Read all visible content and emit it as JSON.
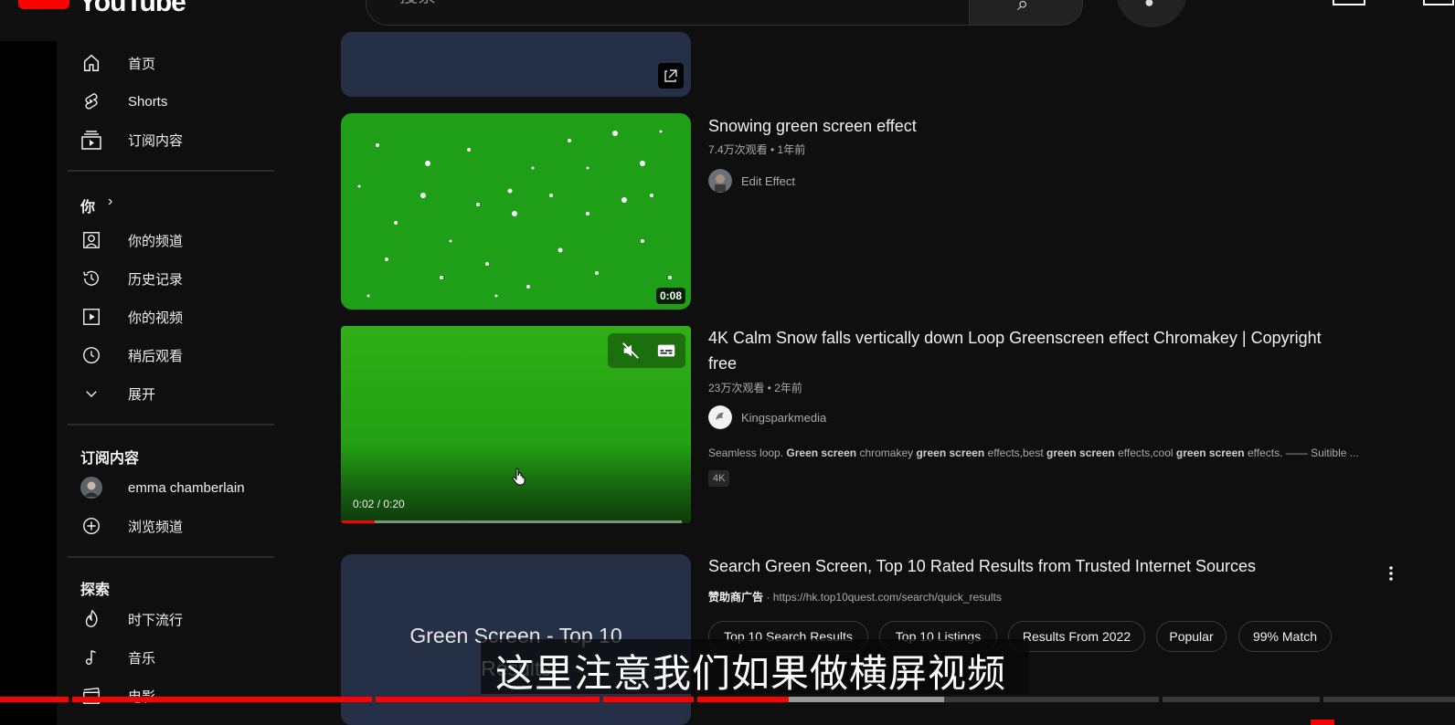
{
  "topbar": {
    "logo_text": "YouTube",
    "search_placeholder": "搜索"
  },
  "sidebar": {
    "main": [
      {
        "label": "首页",
        "icon": "home-icon"
      },
      {
        "label": "Shorts",
        "icon": "shorts-icon"
      },
      {
        "label": "订阅内容",
        "icon": "subscriptions-icon"
      }
    ],
    "you_title": "你",
    "you_items": [
      {
        "label": "你的频道",
        "icon": "channel-icon"
      },
      {
        "label": "历史记录",
        "icon": "history-icon"
      },
      {
        "label": "你的视频",
        "icon": "your-videos-icon"
      },
      {
        "label": "稍后观看",
        "icon": "watch-later-icon"
      },
      {
        "label": "展开",
        "icon": "chevron-down-icon"
      }
    ],
    "subs_title": "订阅内容",
    "subs_items": [
      {
        "label": "emma chamberlain",
        "icon": "avatar"
      },
      {
        "label": "浏览频道",
        "icon": "add-circle-icon"
      }
    ],
    "explore_title": "探索",
    "explore_items": [
      {
        "label": "时下流行",
        "icon": "trending-icon"
      },
      {
        "label": "音乐",
        "icon": "music-icon"
      },
      {
        "label": "电影",
        "icon": "movies-icon"
      }
    ]
  },
  "results": [
    {
      "title": "Snowing green screen effect",
      "meta": "7.4万次观看 • 1年前",
      "channel": "Edit Effect",
      "duration": "0:08"
    },
    {
      "title_line1": "4K Calm Snow falls vertically down Loop Greenscreen effect Chromakey | Copyright",
      "title_line2": "free",
      "meta": "23万次观看 • 2年前",
      "channel": "Kingsparkmedia",
      "desc_parts": [
        "Seamless loop. ",
        "Green screen",
        " chromakey ",
        "green screen",
        " effects,best ",
        "green screen",
        " effects,cool ",
        "green screen",
        " effects. —— Suitible ..."
      ],
      "badge": "4K",
      "time": "0:02 / 0:20",
      "progress": 0.1
    },
    {
      "title": "Search Green Screen, Top 10 Rated Results from Trusted Internet Sources",
      "ad_label": "赞助商广告",
      "ad_url": "https://hk.top10quest.com/search/quick_results",
      "thumb_text_line1": "Green Screen - Top 10",
      "thumb_text_line2": "Results",
      "pills": [
        "Top 10 Search Results",
        "Top 10 Listings",
        "Results From 2022",
        "Popular",
        "99% Match"
      ]
    }
  ],
  "subtitle": "这里注意我们如果做横屏视频",
  "colors": {
    "accent": "#ff0000",
    "green_screen": "#1fa01a"
  }
}
